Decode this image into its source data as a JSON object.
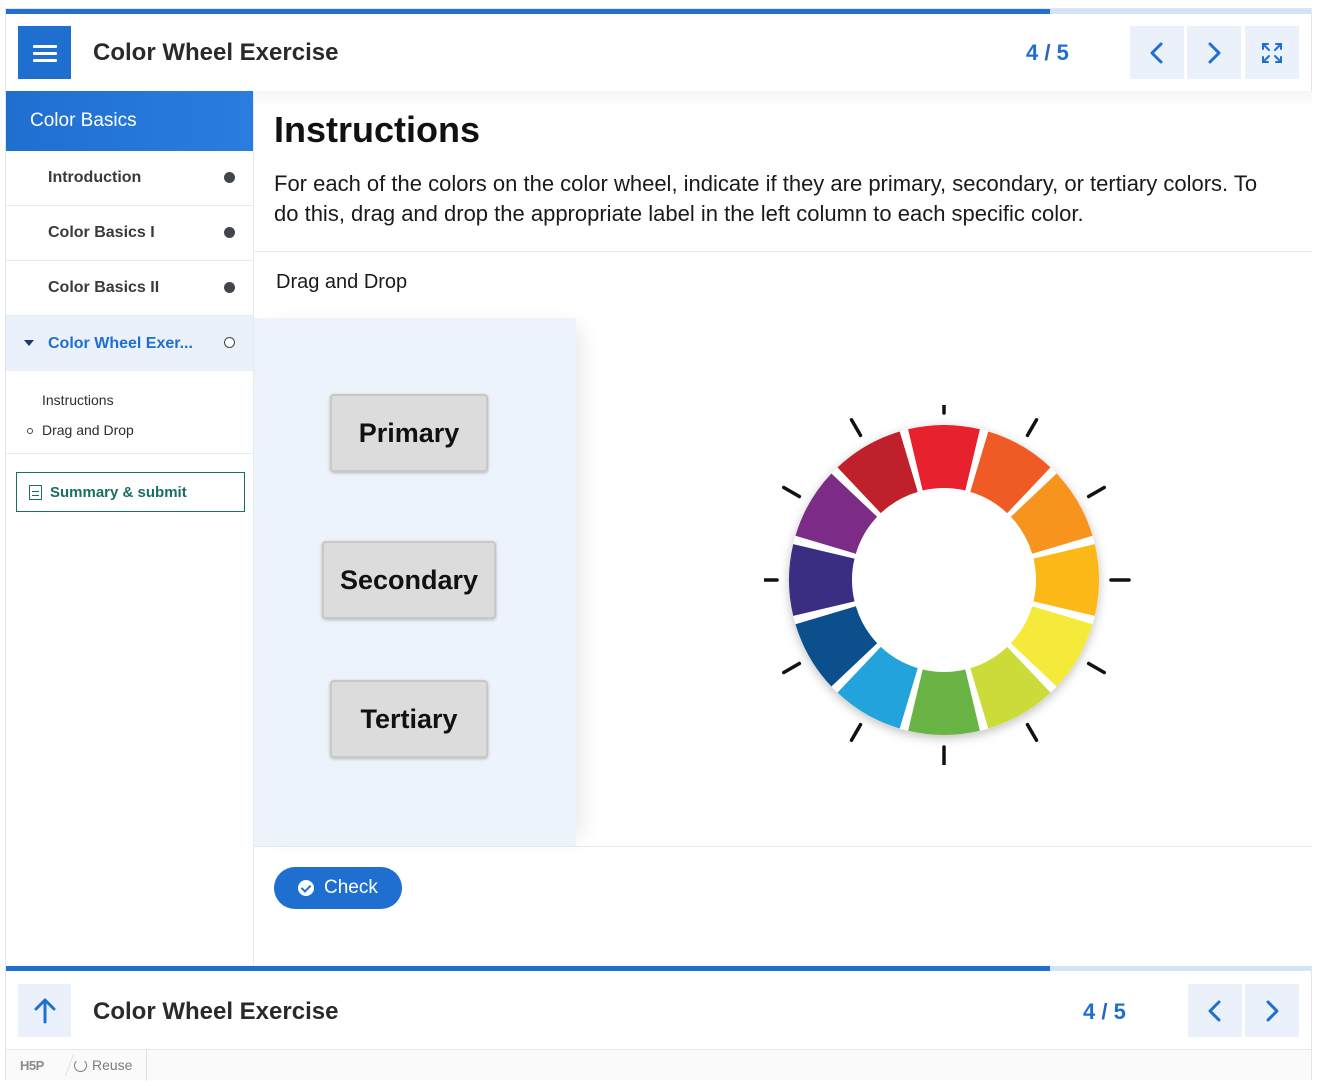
{
  "header": {
    "title": "Color Wheel Exercise",
    "counter_current": "4",
    "counter_sep": "/",
    "counter_total": "5",
    "progress_fraction": 0.8
  },
  "sidebar": {
    "chapter": "Color Basics",
    "items": [
      {
        "label": "Introduction",
        "status": "completed"
      },
      {
        "label": "Color Basics I",
        "status": "completed"
      },
      {
        "label": "Color Basics II",
        "status": "completed"
      },
      {
        "label": "Color Wheel Exer...",
        "status": "current"
      }
    ],
    "subitems": [
      "Instructions",
      "Drag and Drop"
    ],
    "summary_label": "Summary & submit"
  },
  "main": {
    "instructions_title": "Instructions",
    "instructions_text": "For each of the colors on the color wheel, indicate if they are primary, secondary, or tertiary colors. To do this, drag and drop the appropriate label in the left column to each specific color.",
    "dd_label": "Drag and Drop",
    "drag_labels": [
      "Primary",
      "Secondary",
      "Tertiary"
    ],
    "check_label": "Check",
    "wheel_colors": [
      "#e7222e",
      "#f05a24",
      "#f7941e",
      "#fbb817",
      "#f5e93a",
      "#cbdc3a",
      "#6ab446",
      "#22a3dc",
      "#0b4f8c",
      "#3a2e82",
      "#7c2b87",
      "#c0202c"
    ]
  },
  "footer": {
    "title": "Color Wheel Exercise",
    "counter_current": "4",
    "counter_sep": "/",
    "counter_total": "5",
    "reuse_label": "Reuse"
  },
  "colors": {
    "accent": "#1f6fd1",
    "summary": "#1b6e63"
  }
}
